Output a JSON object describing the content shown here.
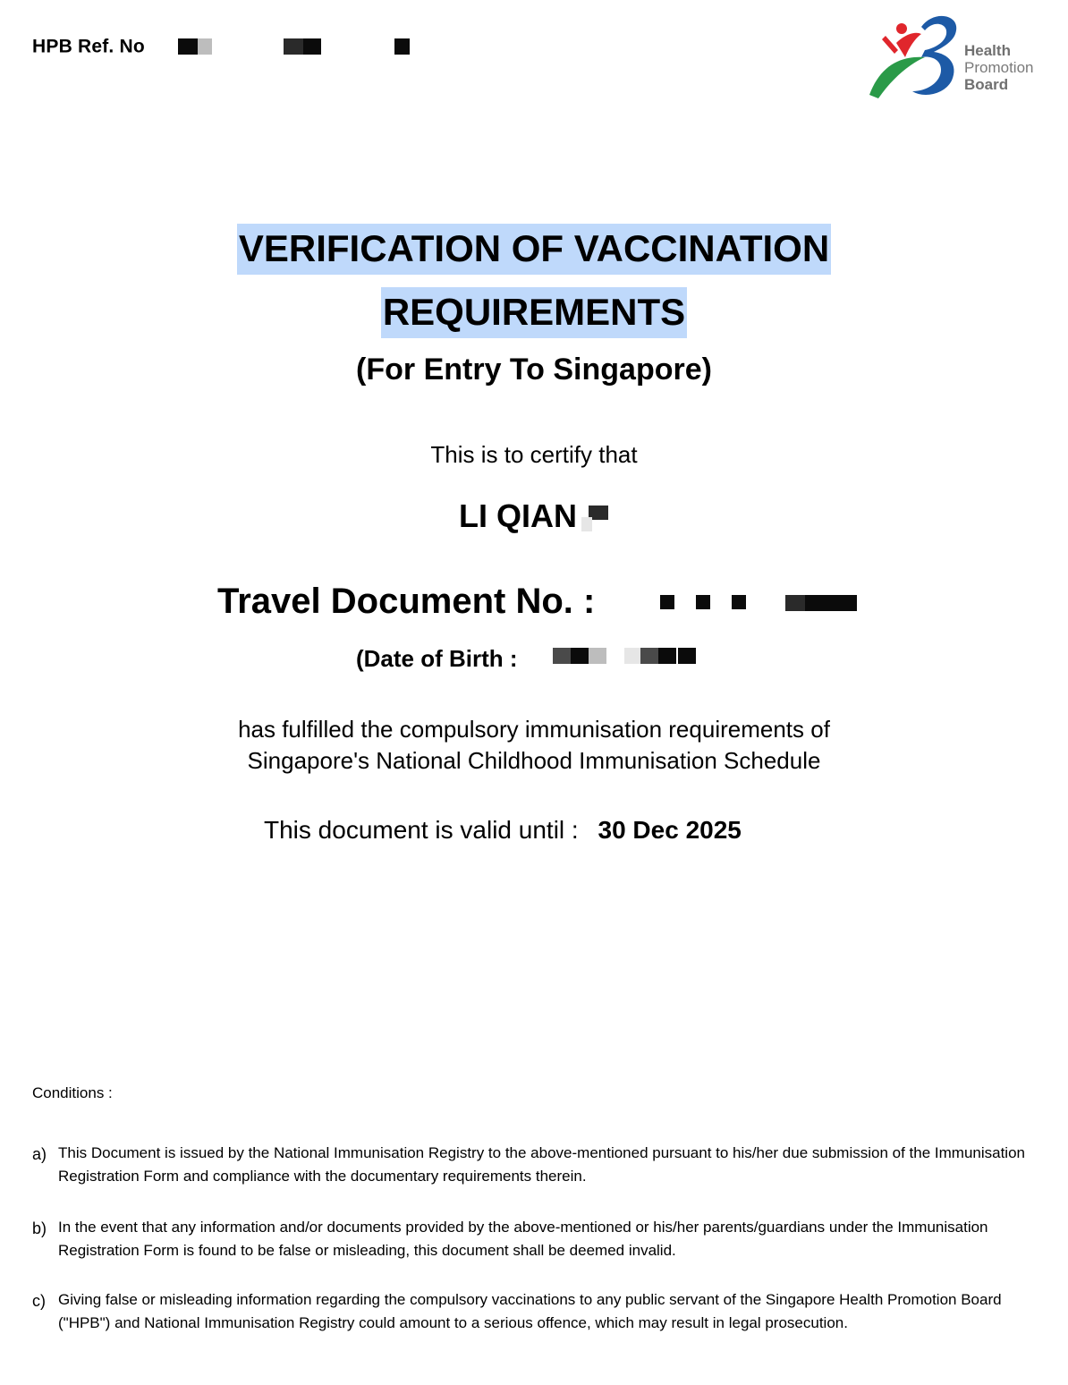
{
  "header": {
    "ref_label": "HPB Ref. No",
    "logo": {
      "icon": "health-promotion-board-logo",
      "line1": "Health",
      "line2": "Promotion",
      "line3": "Board",
      "colors": {
        "red": "#e0262c",
        "green": "#2a9a48",
        "blue": "#1d5aa6",
        "text": "#7a7a7a"
      }
    }
  },
  "title": {
    "line1": "VERIFICATION OF VACCINATION",
    "line2": "REQUIREMENTS",
    "subtitle": "(For Entry To Singapore)",
    "highlight_color": "#bfd9fb"
  },
  "body": {
    "certify": "This is to certify that",
    "name": "LI QIAN",
    "travel_label": "Travel Document No. :",
    "dob_label": "(Date of Birth  :",
    "fulfilled_line1": "has fulfilled the compulsory immunisation requirements of",
    "fulfilled_line2": "Singapore's National Childhood Immunisation Schedule",
    "valid_label": "This document is valid until  :",
    "valid_date": "30 Dec 2025"
  },
  "conditions": {
    "heading": "Conditions :",
    "items": [
      {
        "letter": "a)",
        "text": "This Document is issued by the National Immunisation Registry to the above-mentioned pursuant to his/her due submission of the Immunisation Registration Form and compliance with the documentary requirements therein."
      },
      {
        "letter": "b)",
        "text": "In the event that any information and/or documents provided by the above-mentioned or his/her parents/guardians under the Immunisation Registration Form is found to be false or misleading, this document shall be deemed invalid."
      },
      {
        "letter": "c)",
        "text": "Giving false or misleading information regarding the compulsory vaccinations to any public servant of the Singapore Health Promotion Board (\"HPB\") and National Immunisation Registry could amount to a serious offence, which may result in legal prosecution."
      }
    ]
  }
}
